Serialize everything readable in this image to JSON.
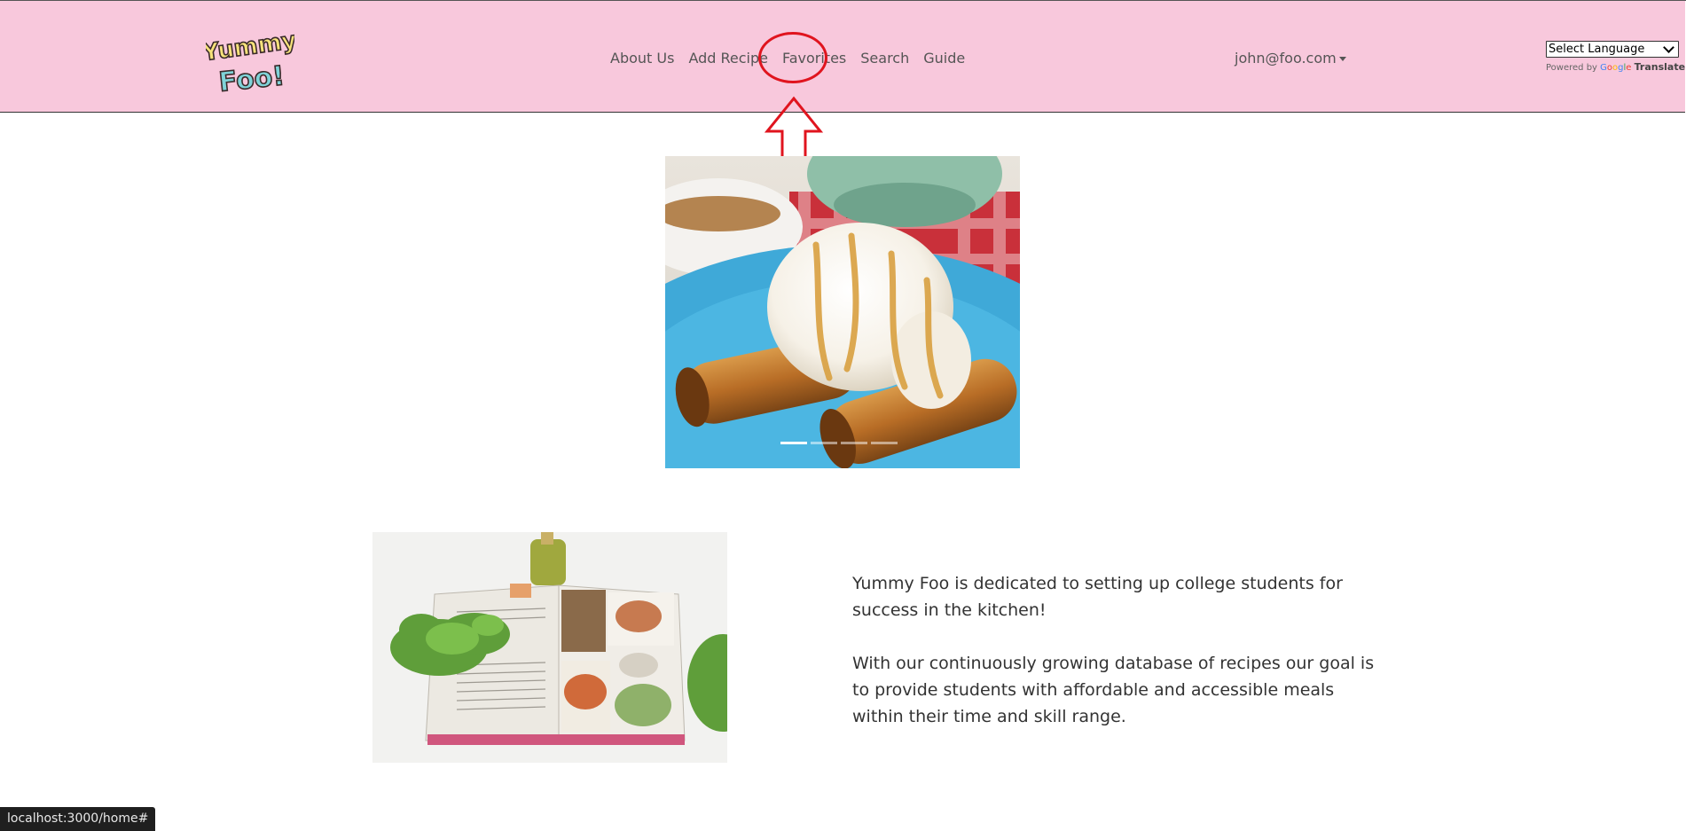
{
  "logo": {
    "text_line1": "Yummy",
    "text_line2": "Foo!"
  },
  "nav": {
    "links": [
      {
        "label": "About Us"
      },
      {
        "label": "Add Recipe"
      },
      {
        "label": "Favorites"
      },
      {
        "label": "Search"
      },
      {
        "label": "Guide"
      }
    ],
    "user": "john@foo.com"
  },
  "translate": {
    "select_label": "Select Language",
    "powered_by": "Powered by",
    "google": [
      "G",
      "o",
      "o",
      "g",
      "l",
      "e"
    ],
    "translate_link": "Translate"
  },
  "carousel": {
    "slide_count": 4,
    "active_index": 0
  },
  "about": {
    "paragraph1": "Yummy Foo is dedicated to setting up college students for success in the kitchen!",
    "paragraph2": "With our continuously growing database of recipes our goal is to provide students with affordable and accessible meals within their time and skill range."
  },
  "status_bar": {
    "url": "localhost:3000/home#"
  },
  "colors": {
    "navbar_bg": "#f8c8dc",
    "annotation": "#e0141e",
    "text": "#333333"
  },
  "icons": {
    "annotation_arrow": "up-arrow-icon",
    "dropdown": "caret-down-icon"
  }
}
